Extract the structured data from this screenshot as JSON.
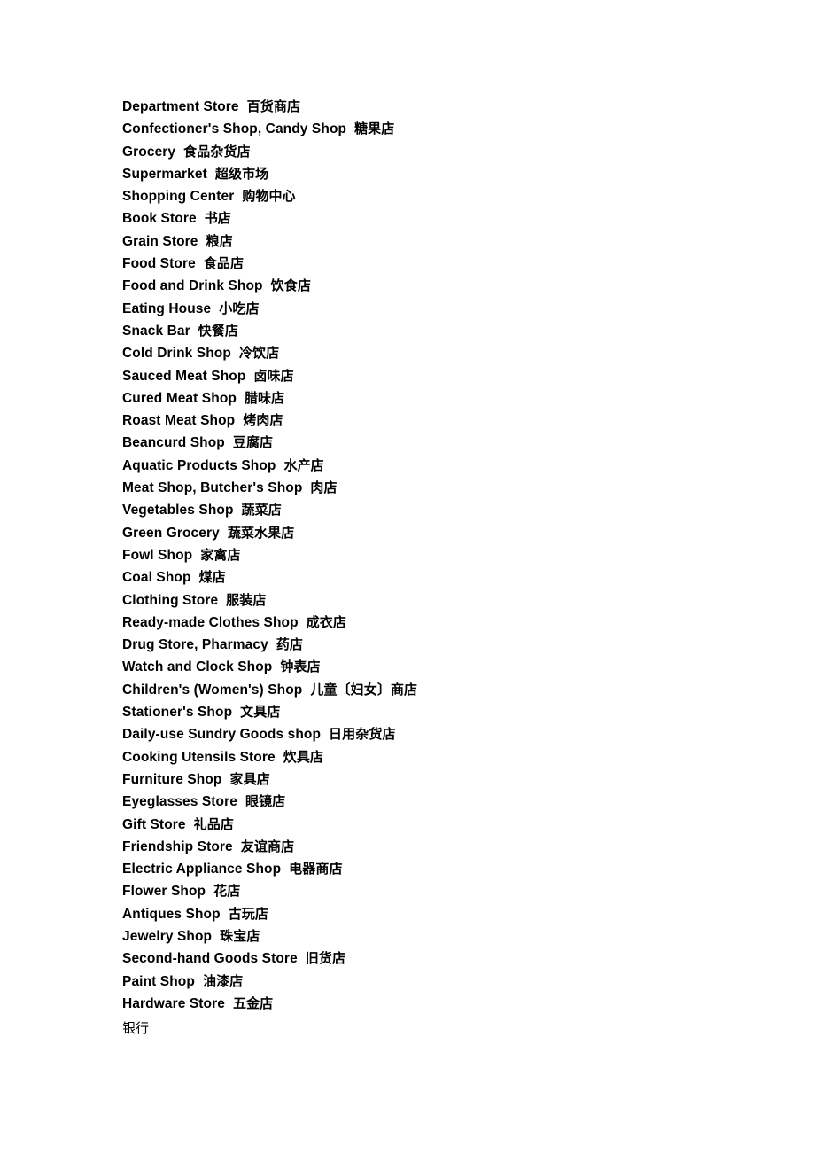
{
  "document": {
    "background_color": "#ffffff",
    "text_color": "#000000"
  },
  "glossary": {
    "entries": [
      {
        "en": "Department Store",
        "zh": "百货商店"
      },
      {
        "en": "Confectioner's Shop, Candy Shop",
        "zh": "糖果店"
      },
      {
        "en": "Grocery",
        "zh": "食品杂货店"
      },
      {
        "en": "Supermarket",
        "zh": "超级市场"
      },
      {
        "en": "Shopping Center",
        "zh": "购物中心"
      },
      {
        "en": "Book Store",
        "zh": "书店"
      },
      {
        "en": "Grain Store",
        "zh": "粮店"
      },
      {
        "en": "Food Store",
        "zh": "食品店"
      },
      {
        "en": "Food and Drink Shop",
        "zh": "饮食店"
      },
      {
        "en": "Eating House",
        "zh": "小吃店"
      },
      {
        "en": "Snack Bar",
        "zh": "快餐店"
      },
      {
        "en": "Cold Drink Shop",
        "zh": "冷饮店"
      },
      {
        "en": "Sauced Meat Shop",
        "zh": "卤味店"
      },
      {
        "en": "Cured Meat Shop",
        "zh": "腊味店"
      },
      {
        "en": "Roast Meat Shop",
        "zh": "烤肉店"
      },
      {
        "en": "Beancurd Shop",
        "zh": "豆腐店"
      },
      {
        "en": "Aquatic Products Shop",
        "zh": "水产店"
      },
      {
        "en": "Meat Shop, Butcher's Shop",
        "zh": "肉店"
      },
      {
        "en": "Vegetables Shop",
        "zh": "蔬菜店"
      },
      {
        "en": "Green Grocery",
        "zh": "蔬菜水果店"
      },
      {
        "en": "Fowl Shop",
        "zh": "家禽店"
      },
      {
        "en": "Coal Shop",
        "zh": "煤店"
      },
      {
        "en": "Clothing Store",
        "zh": "服装店"
      },
      {
        "en": "Ready-made Clothes Shop",
        "zh": "成衣店"
      },
      {
        "en": "Drug Store, Pharmacy",
        "zh": "药店"
      },
      {
        "en": "Watch and Clock Shop",
        "zh": "钟表店"
      },
      {
        "en": "Children's (Women's) Shop",
        "zh": "儿童〔妇女〕商店"
      },
      {
        "en": "Stationer's Shop",
        "zh": "文具店"
      },
      {
        "en": "Daily-use Sundry Goods shop",
        "zh": "日用杂货店"
      },
      {
        "en": "Cooking Utensils Store",
        "zh": "炊具店"
      },
      {
        "en": "Furniture Shop",
        "zh": "家具店"
      },
      {
        "en": "Eyeglasses Store",
        "zh": "眼镜店"
      },
      {
        "en": "Gift Store",
        "zh": "礼品店"
      },
      {
        "en": "Friendship Store",
        "zh": "友谊商店"
      },
      {
        "en": "Electric Appliance Shop",
        "zh": "电器商店"
      },
      {
        "en": "Flower Shop",
        "zh": "花店"
      },
      {
        "en": "Antiques Shop",
        "zh": "古玩店"
      },
      {
        "en": "Jewelry Shop",
        "zh": "珠宝店"
      },
      {
        "en": "Second-hand Goods Store",
        "zh": "旧货店"
      },
      {
        "en": "Paint Shop",
        "zh": "油漆店"
      },
      {
        "en": "Hardware Store",
        "zh": "五金店"
      }
    ]
  },
  "next_section": {
    "heading": "银行"
  }
}
